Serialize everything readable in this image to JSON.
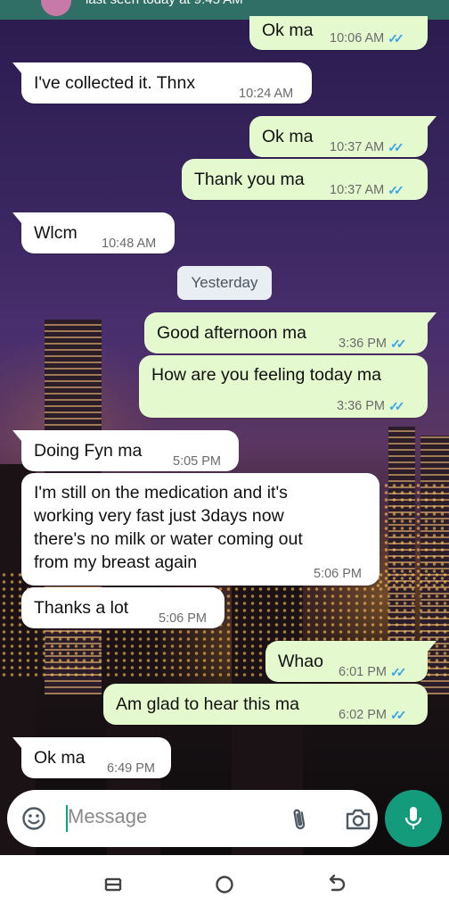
{
  "header": {
    "status": "last seen today at 9:45 AM"
  },
  "composer": {
    "placeholder": "Message"
  },
  "messages": [
    {
      "dir": "out",
      "text": "Ok ma",
      "time": "10:06 AM"
    },
    {
      "dir": "in",
      "text": "I've collected it. Thnx",
      "time": "10:24 AM"
    },
    {
      "dir": "out",
      "text": "Ok ma",
      "time": "10:37 AM"
    },
    {
      "dir": "out",
      "text": "Thank you ma",
      "time": "10:37 AM"
    },
    {
      "dir": "in",
      "text": "Wlcm",
      "time": "10:48 AM"
    },
    {
      "dir": "out",
      "text": "Good afternoon ma",
      "time": "3:36 PM"
    },
    {
      "dir": "out",
      "text": "How are you feeling today ma",
      "time": "3:36 PM"
    },
    {
      "dir": "in",
      "text": "Doing Fyn ma",
      "time": "5:05 PM"
    },
    {
      "dir": "in",
      "lines": [
        "I'm still on the medication and it's",
        "working very fast just 3days now",
        "there's no milk or water coming out",
        "from my breast again"
      ],
      "time": "5:06 PM"
    },
    {
      "dir": "in",
      "text": "Thanks a lot",
      "time": "5:06 PM"
    },
    {
      "dir": "out",
      "text": "Whao",
      "time": "6:01 PM"
    },
    {
      "dir": "out",
      "text": "Am glad to hear this ma",
      "time": "6:02 PM"
    },
    {
      "dir": "in",
      "text": "Ok ma",
      "time": "6:49 PM"
    }
  ],
  "date_separator": "Yesterday",
  "colors": {
    "incoming_bubble": "#ffffff",
    "outgoing_bubble": "#e5f9cf",
    "read_ticks": "#34a5e6",
    "mic_button": "#139b7b",
    "header": "#2f6f66"
  },
  "icons": {
    "emoji": "emoji-icon",
    "attach": "paperclip-icon",
    "camera": "camera-icon",
    "mic": "mic-icon",
    "nav_recents": "recents-icon",
    "nav_home": "home-icon",
    "nav_back": "back-icon"
  }
}
